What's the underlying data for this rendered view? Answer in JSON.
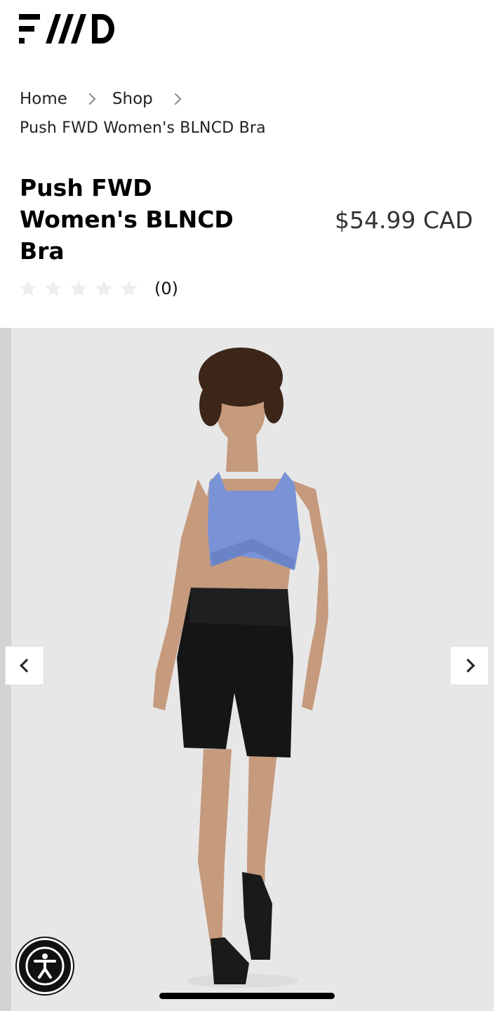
{
  "brand": {
    "logo_text": "FWD",
    "logo_icon": "fwd-logo"
  },
  "breadcrumb": {
    "items": [
      {
        "label": "Home"
      },
      {
        "label": "Shop"
      }
    ],
    "current": "Push FWD Women's BLNCD Bra",
    "separator_icon": "chevron-right-icon"
  },
  "product": {
    "title": "Push FWD Women's BLNCD Bra",
    "price": "$54.99 CAD",
    "rating": {
      "stars_filled": 0,
      "stars_total": 5,
      "count_label": "(0)"
    }
  },
  "gallery": {
    "prev_icon": "chevron-left-icon",
    "next_icon": "chevron-right-icon",
    "image_subject": "model wearing periwinkle blue sports bra and black bike shorts"
  },
  "accessibility": {
    "icon": "accessibility-icon"
  },
  "colors": {
    "background": "#ffffff",
    "gallery_bg": "#e7e7e7",
    "bra_blue": "#7a93d6",
    "shorts_black": "#151515",
    "star_empty": "#eeeeee"
  }
}
